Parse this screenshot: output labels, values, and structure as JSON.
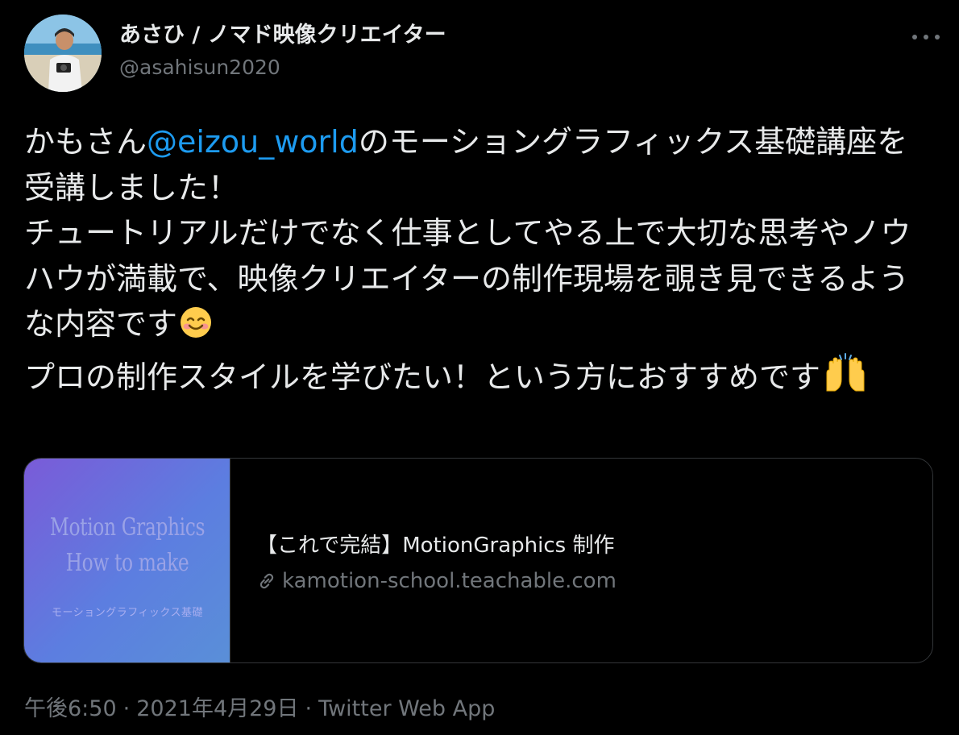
{
  "author": {
    "display_name": "あさひ / ノマド映像クリエイター",
    "handle": "@asahisun2020"
  },
  "tweet": {
    "text_part1": "かもさん",
    "mention": "@eizou_world",
    "text_part2": "のモーショングラフィックス基礎講座を受講しました！\nチュートリアルだけでなく仕事としてやる上で大切な思考やノウハウが満載で、映像クリエイターの制作現場を覗き見できるような内容です",
    "emoji_smile": "smiling-face-icon",
    "text_part3": "\nプロの制作スタイルを学びたい！という方におすすめです",
    "emoji_hands": "raising-hands-icon"
  },
  "card": {
    "thumbnail_line1": "Motion Graphics",
    "thumbnail_line2": "How to make",
    "thumbnail_line3": "モーショングラフィックス基礎",
    "title": "【これで完結】MotionGraphics 制作",
    "domain": "kamotion-school.teachable.com",
    "link_icon": "link-icon"
  },
  "meta": {
    "time": "午後6:50",
    "separator": "·",
    "date": "2021年4月29日",
    "source": "Twitter Web App"
  },
  "colors": {
    "background": "#000000",
    "text": "#e7e9ea",
    "secondary": "#71767b",
    "link": "#1d9bf0",
    "border": "#333639"
  }
}
